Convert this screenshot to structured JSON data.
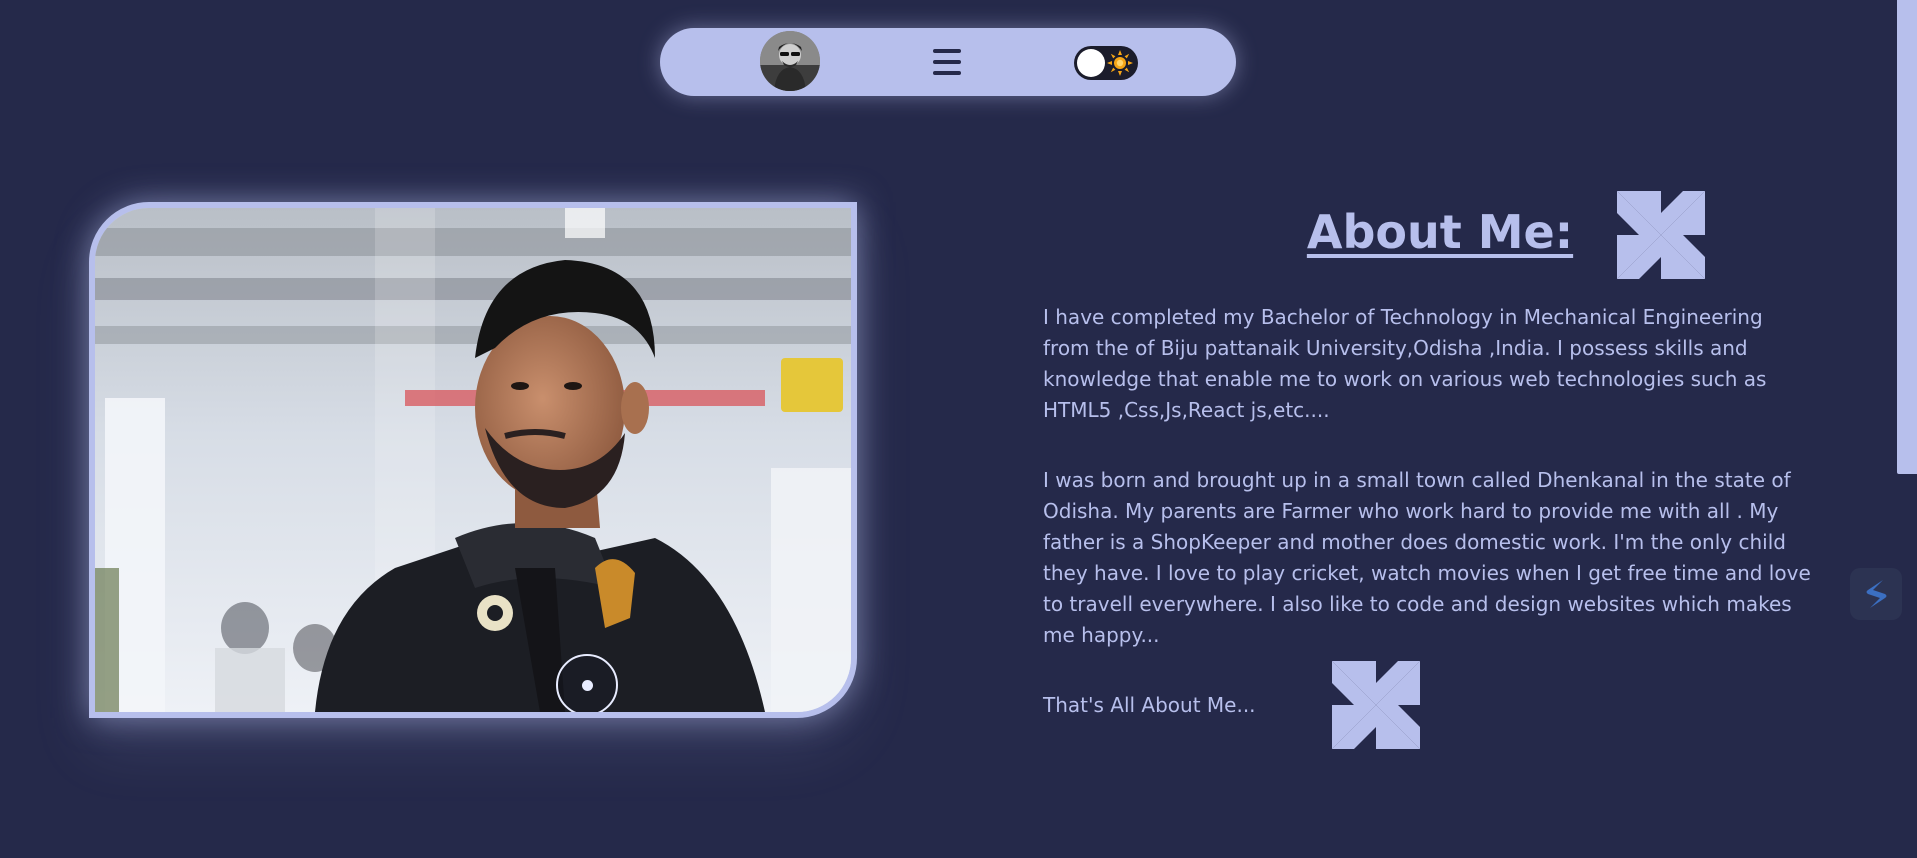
{
  "nav": {
    "avatar": "profile-avatar",
    "menu_icon": "hamburger-menu-icon",
    "theme_toggle": {
      "knob": "toggle-knob",
      "icon": "sun-icon",
      "state": "light-off"
    }
  },
  "photo": {
    "description_icon": "profile-photo",
    "overlay_icon": "disc-icon"
  },
  "about": {
    "title": "About Me:",
    "paragraph1": "I have completed my Bachelor of Technology in Mechanical Engineering from the of Biju pattanaik University,Odisha ,India. I possess skills and knowledge that enable me to work on various web technologies such as HTML5 ,Css,Js,React js,etc....",
    "paragraph2": "I was born and brought up in a small town called Dhenkanal in the state of Odisha. My parents are Farmer who work hard to provide me with all . My father is a ShopKeeper and mother does domestic work. I'm the only child they have. I love to play cricket, watch movies when I get free time and love to travell everywhere. I also like to code and design websites which makes me happy...",
    "closing": "That's All About Me..."
  },
  "decor": {
    "pinwheel_icon": "pinwheel-icon",
    "side_badge_icon": "stack-logo-icon"
  },
  "colors": {
    "background": "#25294a",
    "accent": "#b7bfec",
    "text": "#b7bfec",
    "toggle_bg": "#1b1c2b",
    "sun": "#f5a516"
  }
}
